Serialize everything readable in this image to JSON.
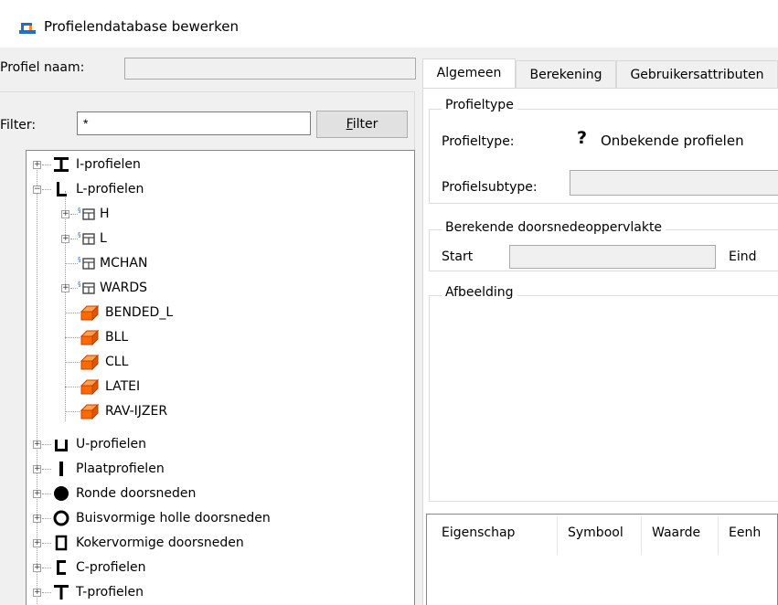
{
  "window": {
    "title": "Profielendatabase bewerken",
    "icon": "database-edit-icon"
  },
  "profile_name": {
    "label": "Profiel naam:",
    "value": ""
  },
  "filter": {
    "label": "Filter:",
    "value": "*",
    "button_label": "Filter",
    "button_accel": "F"
  },
  "tree": {
    "items": [
      {
        "label": "I-profielen",
        "icon": "i-beam-icon",
        "expander": "+"
      },
      {
        "label": "L-profielen",
        "icon": "l-angle-icon",
        "expander": "-"
      },
      {
        "label": "H",
        "icon": "library-icon",
        "expander": "+"
      },
      {
        "label": "L",
        "icon": "library-icon",
        "expander": "+"
      },
      {
        "label": "MCHAN",
        "icon": "library-icon",
        "expander": ""
      },
      {
        "label": "WARDS",
        "icon": "library-icon",
        "expander": "+"
      },
      {
        "label": "BENDED_L",
        "icon": "profile-3d-icon",
        "expander": ""
      },
      {
        "label": "BLL",
        "icon": "profile-3d-icon",
        "expander": ""
      },
      {
        "label": "CLL",
        "icon": "profile-3d-icon",
        "expander": ""
      },
      {
        "label": "LATEI",
        "icon": "profile-3d-icon",
        "expander": ""
      },
      {
        "label": "RAV-IJZER",
        "icon": "profile-3d-icon",
        "expander": ""
      },
      {
        "label": "U-profielen",
        "icon": "u-channel-icon",
        "expander": "+"
      },
      {
        "label": "Plaatprofielen",
        "icon": "plate-icon",
        "expander": "+"
      },
      {
        "label": "Ronde doorsneden",
        "icon": "round-bar-icon",
        "expander": "+"
      },
      {
        "label": "Buisvormige holle doorsneden",
        "icon": "tube-icon",
        "expander": "+"
      },
      {
        "label": "Kokervormige doorsneden",
        "icon": "box-section-icon",
        "expander": "+"
      },
      {
        "label": "C-profielen",
        "icon": "c-channel-icon",
        "expander": "+"
      },
      {
        "label": "T-profielen",
        "icon": "t-beam-icon",
        "expander": "+"
      }
    ]
  },
  "tabs": [
    {
      "label": "Algemeen",
      "active": true
    },
    {
      "label": "Berekening",
      "active": false
    },
    {
      "label": "Gebruikersattributen",
      "active": false
    }
  ],
  "profiletype_group": {
    "title": "Profieltype",
    "type_label": "Profieltype:",
    "type_value": "Onbekende profielen",
    "type_icon": "?",
    "subtype_label": "Profielsubtype:",
    "subtype_value": ""
  },
  "area_group": {
    "title": "Berekende doorsnedeoppervlakte",
    "start_label": "Start",
    "start_value": "",
    "end_label": "Eind"
  },
  "image_group": {
    "title": "Afbeelding"
  },
  "properties_table": {
    "columns": [
      "Eigenschap",
      "Symbool",
      "Waarde",
      "Eenh"
    ]
  },
  "colors": {
    "accent": "#1f6fc5",
    "profile_orange": "#ff6a00",
    "tree_line": "#a0a0a0"
  }
}
